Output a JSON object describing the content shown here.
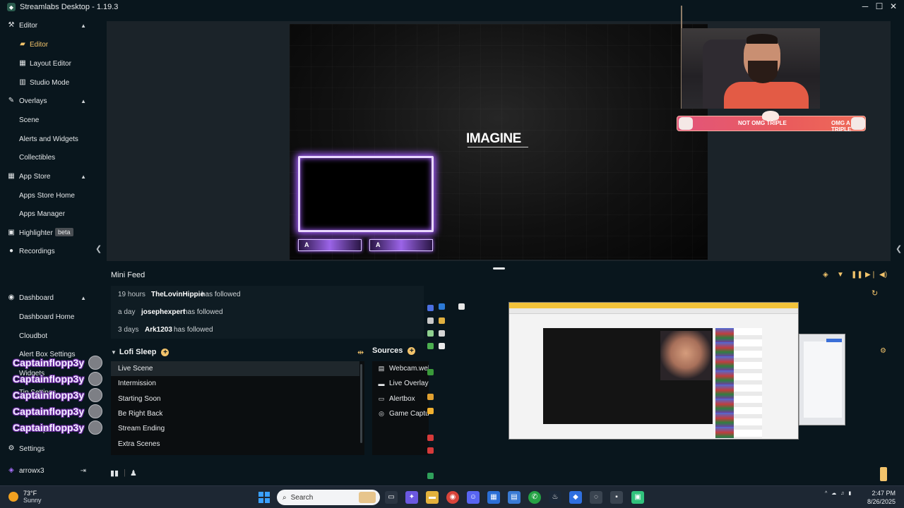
{
  "app": {
    "title": "Streamlabs Desktop - 1.19.3",
    "window_controls": {
      "minimize": "─",
      "maximize": "☐",
      "close": "✕"
    }
  },
  "sidebar": {
    "sections": [
      {
        "label": "Editor",
        "icon": "palette-icon",
        "glyph": "⚒",
        "chevron": "▲"
      },
      {
        "label": "Overlays",
        "icon": "brush-icon",
        "glyph": "✎",
        "chevron": "▲"
      },
      {
        "label": "App Store",
        "icon": "store-icon",
        "glyph": "▦",
        "chevron": "▲"
      },
      {
        "label": "Highlighter",
        "icon": "highlighter-icon",
        "glyph": "▣",
        "badge": "beta"
      },
      {
        "label": "Recordings",
        "icon": "record-icon",
        "glyph": "●"
      },
      {
        "label": "Dashboard",
        "icon": "dashboard-icon",
        "glyph": "◉",
        "chevron": "▲"
      }
    ],
    "editor_items": [
      {
        "label": "Editor",
        "icon": "folder-icon",
        "glyph": "▰"
      },
      {
        "label": "Layout Editor",
        "icon": "layout-icon",
        "glyph": "▦"
      },
      {
        "label": "Studio Mode",
        "icon": "studio-mode-icon",
        "glyph": "▥"
      }
    ],
    "overlay_items": [
      "Scene",
      "Alerts and Widgets",
      "Collectibles"
    ],
    "app_store_items": [
      "Apps Store Home",
      "Apps Manager"
    ],
    "dashboard_items": [
      "Dashboard Home",
      "Cloudbot",
      "Alert Box Settings",
      "Widgets",
      "Tip Settings",
      "Get Help"
    ],
    "settings_label": "Settings",
    "account_label": "arrowx3"
  },
  "chat_overlay": {
    "username": "Captainflopp3y",
    "count": 5
  },
  "preview": {
    "overlay_text": "IMAGINE",
    "goal_left_text": "NOT OMG TRIPLE",
    "goal_right_text": "OMG A TRIPLE"
  },
  "mini_feed": {
    "title": "Mini Feed",
    "events": [
      {
        "time": "19 hours",
        "name": "TheLovinHippie",
        "action": "has followed"
      },
      {
        "time": "a day",
        "name": "josephexpert",
        "action": "has followed"
      },
      {
        "time": "3 days",
        "name": "Ark1203",
        "action": "has followed"
      }
    ]
  },
  "scenes": {
    "collection_name": "Lofi Sleep",
    "items": [
      "Live Scene",
      "Intermission",
      "Starting Soon",
      "Be Right Back",
      "Stream Ending",
      "Extra Scenes"
    ],
    "active_index": 0
  },
  "sources": {
    "title": "Sources",
    "items": [
      {
        "label": "Webcam.web",
        "icon": "file-icon",
        "glyph": "▤"
      },
      {
        "label": "Live Overlay",
        "icon": "folder-icon",
        "glyph": "▬"
      },
      {
        "label": "Alertbox",
        "icon": "alertbox-icon",
        "glyph": "▭"
      },
      {
        "label": "Game Captur",
        "icon": "gamepad-icon",
        "glyph": "◎"
      }
    ]
  },
  "taskbar": {
    "temperature": "73°F",
    "condition": "Sunny",
    "search_placeholder": "Search",
    "time": "2:47 PM",
    "date": "8/26/2025"
  },
  "colors": {
    "accent": "#f2c36b",
    "background": "#09161d",
    "panel": "#0b0e10",
    "glow": "#a45cff"
  }
}
